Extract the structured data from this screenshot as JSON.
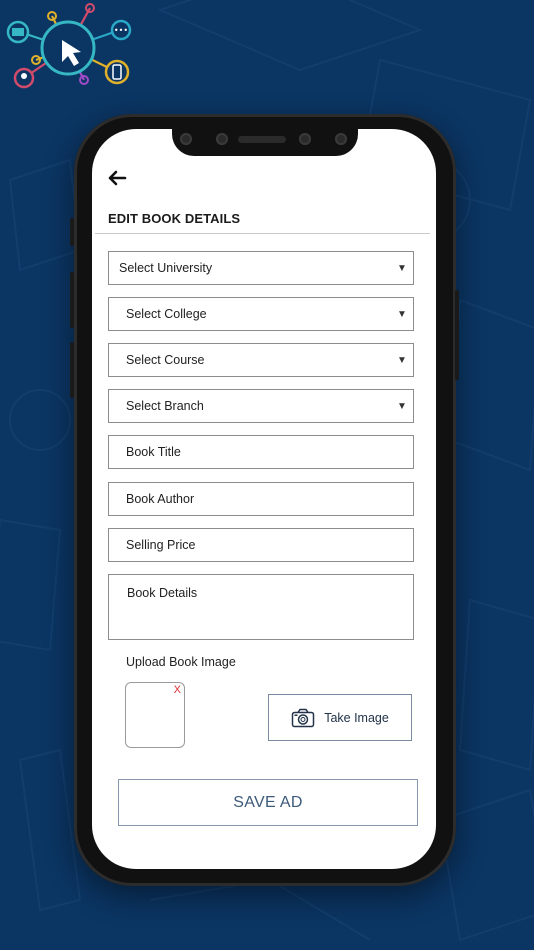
{
  "header": {
    "title": "EDIT BOOK DETAILS"
  },
  "form": {
    "university": "Select University",
    "college": "Select College",
    "course": "Select Course",
    "branch": "Select Branch",
    "book_title_placeholder": "Book Title",
    "book_author_placeholder": "Book Author",
    "selling_price_placeholder": "Selling Price",
    "book_details_placeholder": "Book Details",
    "upload_label": "Upload Book Image",
    "remove_image": "X",
    "take_image_label": "Take Image",
    "save_label": "SAVE AD"
  },
  "icons": {
    "back": "arrow-left-icon",
    "dropdown": "caret-down-icon",
    "camera": "camera-icon",
    "logo": "app-logo"
  },
  "colors": {
    "background": "#0b3563",
    "screen": "#ffffff",
    "remove": "#e03030",
    "save_text": "#3c5a7a"
  }
}
